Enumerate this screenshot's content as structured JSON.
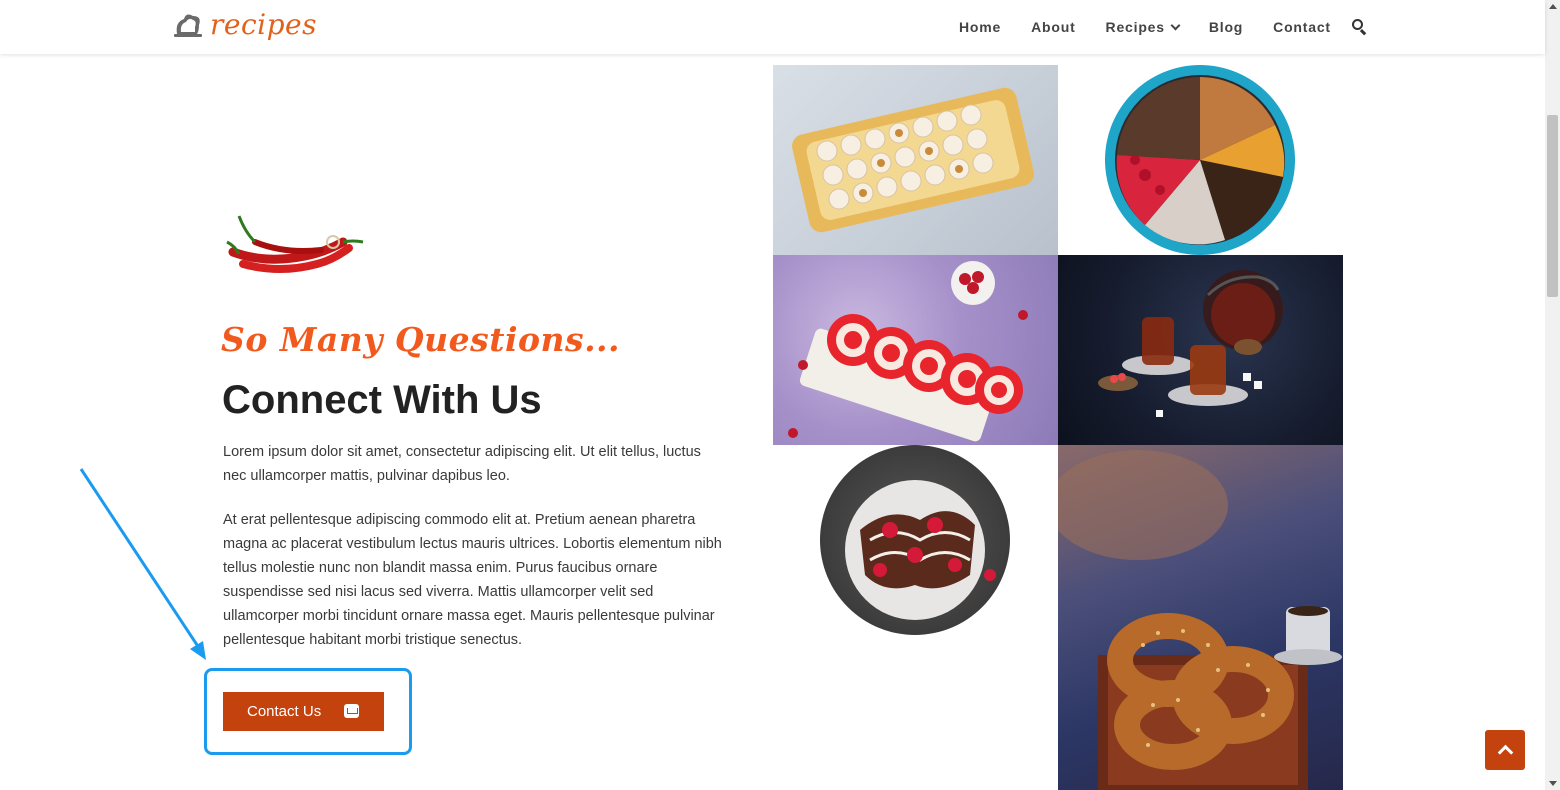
{
  "header": {
    "logo_text": "recipes",
    "nav": [
      {
        "label": "Home"
      },
      {
        "label": "About"
      },
      {
        "label": "Recipes",
        "has_dropdown": true
      },
      {
        "label": "Blog"
      },
      {
        "label": "Contact"
      }
    ],
    "search_icon": "search-icon"
  },
  "main": {
    "tagline": "So Many Questions...",
    "heading": "Connect With Us",
    "paragraph1": "Lorem ipsum dolor sit amet, consectetur adipiscing elit. Ut elit tellus, luctus nec ullamcorper mattis, pulvinar dapibus leo.",
    "paragraph2": "At erat pellentesque adipiscing commodo elit at. Pretium aenean pharetra magna ac placerat vestibulum lectus mauris ultrices. Lobortis elementum nibh tellus molestie nunc non blandit massa enim. Purus faucibus ornare suspendisse sed nisi lacus sed viverra. Mattis ullamcorper velit sed ullamcorper morbi tincidunt ornare massa eget. Mauris pellentesque pulvinar pellentesque habitant morbi tristique senectus.",
    "contact_button": {
      "label": "Contact Us",
      "icon": "envelope-icon"
    }
  },
  "gallery": {
    "images": [
      "turkish-delight-photo",
      "cake-slices-photo",
      "swiss-roll-photo",
      "tea-glasses-photo",
      "chocolate-crepes-photo",
      "simit-bread-photo"
    ]
  },
  "colors": {
    "brand_orange": "#e2621b",
    "tagline_orange": "#f2591d",
    "button_red": "#c4420e",
    "annotation_blue": "#1a9bf0"
  },
  "scroll_to_top_icon": "chevron-up-icon"
}
